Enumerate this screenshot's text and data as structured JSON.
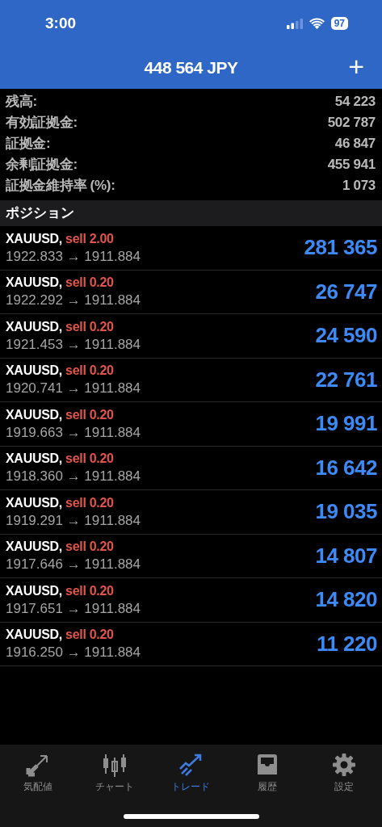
{
  "status_bar": {
    "time": "3:00",
    "battery": "97"
  },
  "header": {
    "title": "448 564 JPY",
    "action": "+"
  },
  "summary": [
    {
      "label": "残高:",
      "value": "54 223"
    },
    {
      "label": "有効証拠金:",
      "value": "502 787"
    },
    {
      "label": "証拠金:",
      "value": "46 847"
    },
    {
      "label": "余剰証拠金:",
      "value": "455 941"
    },
    {
      "label": "証拠金維持率 (%):",
      "value": "1 073"
    }
  ],
  "positions_title": "ポジション",
  "positions": [
    {
      "symbol": "XAUUSD,",
      "order": "sell 2.00",
      "prices": "1922.833 → 1911.884",
      "profit": "281 365"
    },
    {
      "symbol": "XAUUSD,",
      "order": "sell 0.20",
      "prices": "1922.292 → 1911.884",
      "profit": "26 747"
    },
    {
      "symbol": "XAUUSD,",
      "order": "sell 0.20",
      "prices": "1921.453 → 1911.884",
      "profit": "24 590"
    },
    {
      "symbol": "XAUUSD,",
      "order": "sell 0.20",
      "prices": "1920.741 → 1911.884",
      "profit": "22 761"
    },
    {
      "symbol": "XAUUSD,",
      "order": "sell 0.20",
      "prices": "1919.663 → 1911.884",
      "profit": "19 991"
    },
    {
      "symbol": "XAUUSD,",
      "order": "sell 0.20",
      "prices": "1918.360 → 1911.884",
      "profit": "16 642"
    },
    {
      "symbol": "XAUUSD,",
      "order": "sell 0.20",
      "prices": "1919.291 → 1911.884",
      "profit": "19 035"
    },
    {
      "symbol": "XAUUSD,",
      "order": "sell 0.20",
      "prices": "1917.646 → 1911.884",
      "profit": "14 807"
    },
    {
      "symbol": "XAUUSD,",
      "order": "sell 0.20",
      "prices": "1917.651 → 1911.884",
      "profit": "14 820"
    },
    {
      "symbol": "XAUUSD,",
      "order": "sell 0.20",
      "prices": "1916.250 → 1911.884",
      "profit": "11 220"
    }
  ],
  "tabs": [
    {
      "label": "気配値",
      "kind": "quotes",
      "selected": false
    },
    {
      "label": "チャート",
      "kind": "chart",
      "selected": false
    },
    {
      "label": "トレード",
      "kind": "trade",
      "selected": true
    },
    {
      "label": "履歴",
      "kind": "history",
      "selected": false
    },
    {
      "label": "設定",
      "kind": "settings",
      "selected": false
    }
  ]
}
